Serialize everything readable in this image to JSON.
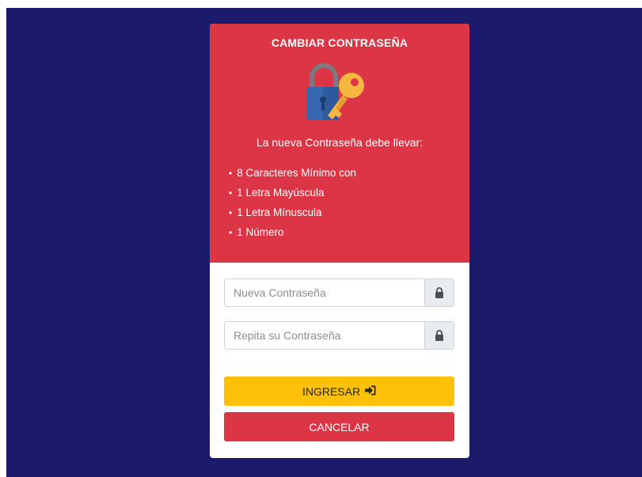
{
  "card": {
    "title": "CAMBIAR CONTRASEÑA",
    "icon": "lock-key-icon",
    "subtitle": "La nueva Contraseña debe llevar:",
    "requirements": [
      "8 Caracteres Mínimo con",
      "1 Letra Mayúscula",
      "1 Letra Mínuscula",
      "1 Número"
    ]
  },
  "form": {
    "new_password_placeholder": "Nueva Contraseña",
    "repeat_password_placeholder": "Repita su Contraseña",
    "submit_label": "INGRESAR",
    "cancel_label": "CANCELAR"
  },
  "colors": {
    "background": "#1b1a6b",
    "header": "#dc3545",
    "submit": "#ffc107",
    "cancel": "#dc3545"
  }
}
